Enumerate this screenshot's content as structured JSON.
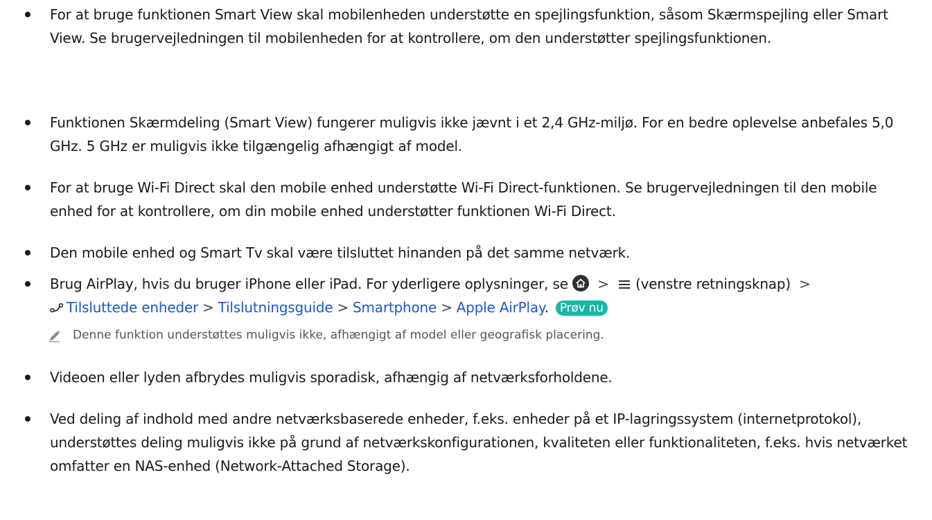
{
  "bullets": [
    {
      "text": "For at bruge funktionen Smart View skal mobilenheden understøtte en spejlingsfunktion, såsom Skærmspejling eller Smart View. Se brugervejledningen til mobilenheden for at kontrollere, om den understøtter spejlingsfunktionen."
    },
    {
      "text": "Funktionen Skærmdeling (Smart View) fungerer muligvis ikke jævnt i et 2,4 GHz-miljø. For en bedre oplevelse anbefales 5,0 GHz. 5 GHz er muligvis ikke tilgængelig afhængigt af model."
    },
    {
      "text": "For at bruge Wi-Fi Direct skal den mobile enhed understøtte Wi-Fi Direct-funktionen. Se brugervejledningen til den mobile enhed for at kontrollere, om din mobile enhed understøtter funktionen Wi-Fi Direct."
    },
    {
      "text": "Den mobile enhed og Smart Tv skal være tilsluttet hinanden på det samme netværk."
    },
    {
      "text_before_icon": "Brug AirPlay, hvis du bruger iPhone eller iPad. For yderligere oplysninger, se",
      "text_after_menu": "(venstre retningsknap)",
      "path": [
        "Tilsluttede enheder",
        "Tilslutningsguide",
        "Smartphone",
        "Apple AirPlay"
      ],
      "path_end": ".",
      "try_now": "Prøv nu",
      "icons": [
        "home-icon",
        "menu-icon",
        "connected-devices-icon"
      ]
    },
    {
      "text": "Videoen eller lyden afbrydes muligvis sporadisk, afhængig af netværksforholdene."
    },
    {
      "text": "Ved deling af indhold med andre netværksbaserede enheder, f.eks. enheder på et IP-lagringssystem (internetprotokol), understøttes deling muligvis ikke på grund af netværkskonfigurationen, kvaliteten eller funktionaliteten, f.eks. hvis netværket omfatter en NAS-enhed (Network-Attached Storage)."
    }
  ],
  "note": {
    "icon": "pencil-icon",
    "text": "Denne funktion understøttes muligvis ikke, afhængigt af model eller geografisk placering."
  },
  "colors": {
    "link": "#1a59c7",
    "try_now_badge": "#17b7a5",
    "text": "#1a1a1a"
  }
}
